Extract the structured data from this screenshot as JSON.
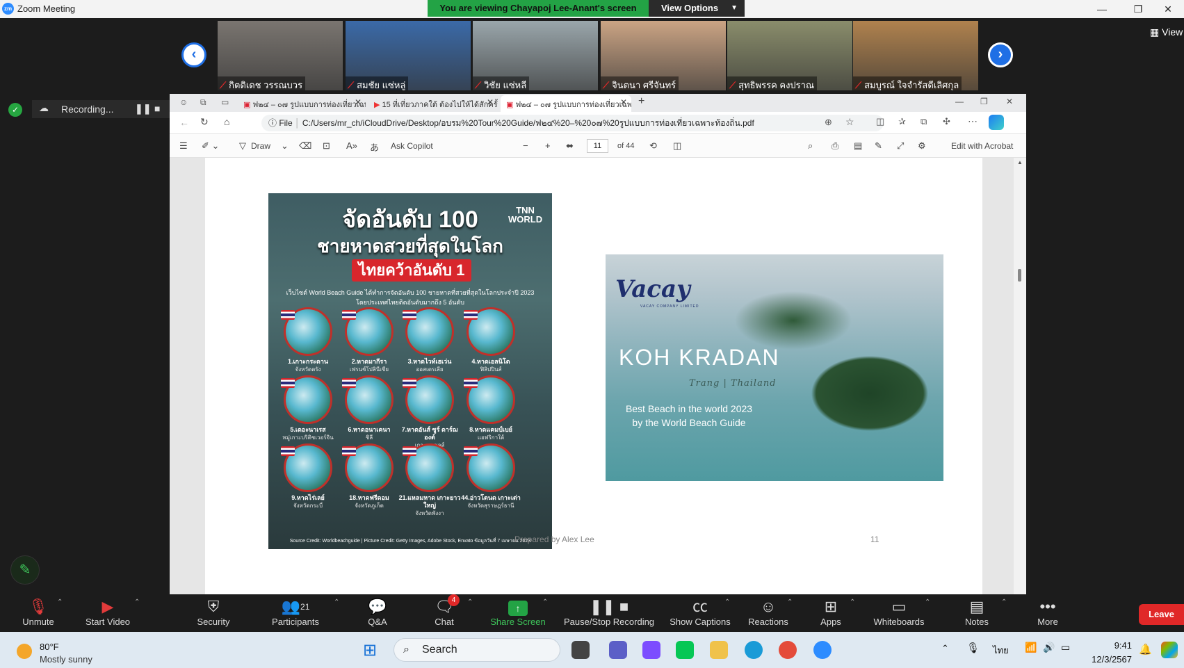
{
  "window": {
    "title": "Zoom Meeting",
    "min": "—",
    "restore": "❐",
    "close": "✕"
  },
  "banner": {
    "viewing": "You are viewing Chayapoj Lee-Anant's screen",
    "view_options": "View Options"
  },
  "gallery": {
    "participants": [
      {
        "name": "กิตติเดช วรรณบวร",
        "bg": "#7a7570"
      },
      {
        "name": "สมชัย แซ่หลู่",
        "bg": "#3b6aa8"
      },
      {
        "name": "วิชัย แซ่หลี",
        "bg": "#9aa6ab"
      },
      {
        "name": "จินตนา ศรีจันทร์",
        "bg": "#cba484"
      },
      {
        "name": "สุทธิพรรค คงปราณ",
        "bg": "#8a8d6b"
      },
      {
        "name": "สมบูรณ์ ใจจำรัสดีเลิศกุล",
        "bg": "#b0824e"
      }
    ],
    "view_label": "View"
  },
  "recording": {
    "label": "Recording..."
  },
  "browser": {
    "tabs": [
      {
        "label": "ฟ๒๔ – ๐๗ รูปแบบการท่องเที่ยวเฉพาะ",
        "active": false
      },
      {
        "label": "15 ที่เที่ยวภาคใต้ ต้องไปให้ได้สักครั้ง",
        "active": false
      },
      {
        "label": "ฟ๒๔ – ๐๗ รูปแบบการท่องเที่ยวเฉพาะ",
        "active": true
      }
    ],
    "url_prefix": "File",
    "url": "C:/Users/mr_ch/iCloudDrive/Desktop/อบรม%20Tour%20Guide/ฟ๒๔%20–%20๐๗%20รูปแบบการท่องเที่ยวเฉพาะท้องถิ่น.pdf",
    "toolbar": {
      "draw": "Draw",
      "ask_copilot": "Ask Copilot",
      "page": "11",
      "of_pages": "of 44",
      "edit_acrobat": "Edit with Acrobat"
    }
  },
  "pdf": {
    "poster": {
      "title1": "จัดอันดับ 100",
      "title2": "ชายหาดสวยที่สุดในโลก",
      "highlight": "ไทยคว้าอันดับ 1",
      "logo": "TNN\nWORLD",
      "desc1": "เว็บไซต์ World Beach Guide ได้ทำการจัดอันดับ 100 ชายหาดที่สวยที่สุดในโลกประจำปี 2023",
      "desc2": "โดยประเทศไทยติดอันดับมากถึง 5 อันดับ",
      "beaches": [
        {
          "name": "1.เกาะกระดาน",
          "sub": "จังหวัดตรัง"
        },
        {
          "name": "2.หาดมากีรา",
          "sub": "เฟรนช์โปลินีเซีย"
        },
        {
          "name": "3.หาดไวท์เฮเว่น",
          "sub": "ออสเตรเลีย"
        },
        {
          "name": "4.หาดเอลนิโด",
          "sub": "ฟิลิปปินส์"
        },
        {
          "name": "5.เดอะนาเรส",
          "sub": "หมู่เกาะบริติชเวอร์จิน"
        },
        {
          "name": "6.หาดอนาเคนา",
          "sub": "ชิลี"
        },
        {
          "name": "7.หาดอันส์ ซูร์ ดาร์ฌองต์",
          "sub": "เกาะเซเชลส์"
        },
        {
          "name": "8.หาดแคมป์เบย์",
          "sub": "แอฟริกาใต้"
        },
        {
          "name": "9.หาดไร่เลย์",
          "sub": "จังหวัดกระบี่"
        },
        {
          "name": "18.หาดฟรีดอม",
          "sub": "จังหวัดภูเก็ต"
        },
        {
          "name": "21.แหลมหาด เกาะยาวใหญ่",
          "sub": "จังหวัดพังงา"
        },
        {
          "name": "44.อ่าวโตนด เกาะเต่า",
          "sub": "จังหวัดสุราษฎร์ธานี"
        }
      ],
      "credit": "Source Credit: Worldbeachguide | Picture Credit: Getty Images, Adobe Stock, Envato   ข้อมูลวันที่ 7 เมษายน 2023"
    },
    "photo": {
      "brand": "Vacay",
      "brand_sub": "VACAY COMPANY LIMITED",
      "place": "KOH KRADAN",
      "location": "Trang | Thailand",
      "best1": "Best Beach in the world 2023",
      "best2": "by the World Beach Guide"
    },
    "footer": {
      "prepared": "Prepared by Alex Lee",
      "page_number": "11"
    }
  },
  "controls": {
    "unmute": "Unmute",
    "start_video": "Start Video",
    "security": "Security",
    "participants": "Participants",
    "participants_count": "21",
    "qa": "Q&A",
    "chat": "Chat",
    "chat_badge": "4",
    "share_screen": "Share Screen",
    "pause_recording": "Pause/Stop Recording",
    "captions": "Show Captions",
    "reactions": "Reactions",
    "apps": "Apps",
    "whiteboards": "Whiteboards",
    "notes": "Notes",
    "more": "More",
    "leave": "Leave"
  },
  "taskbar": {
    "temp": "80°F",
    "weather": "Mostly sunny",
    "search": "Search",
    "lang": "ไทย",
    "time": "9:41",
    "date": "12/3/2567"
  }
}
